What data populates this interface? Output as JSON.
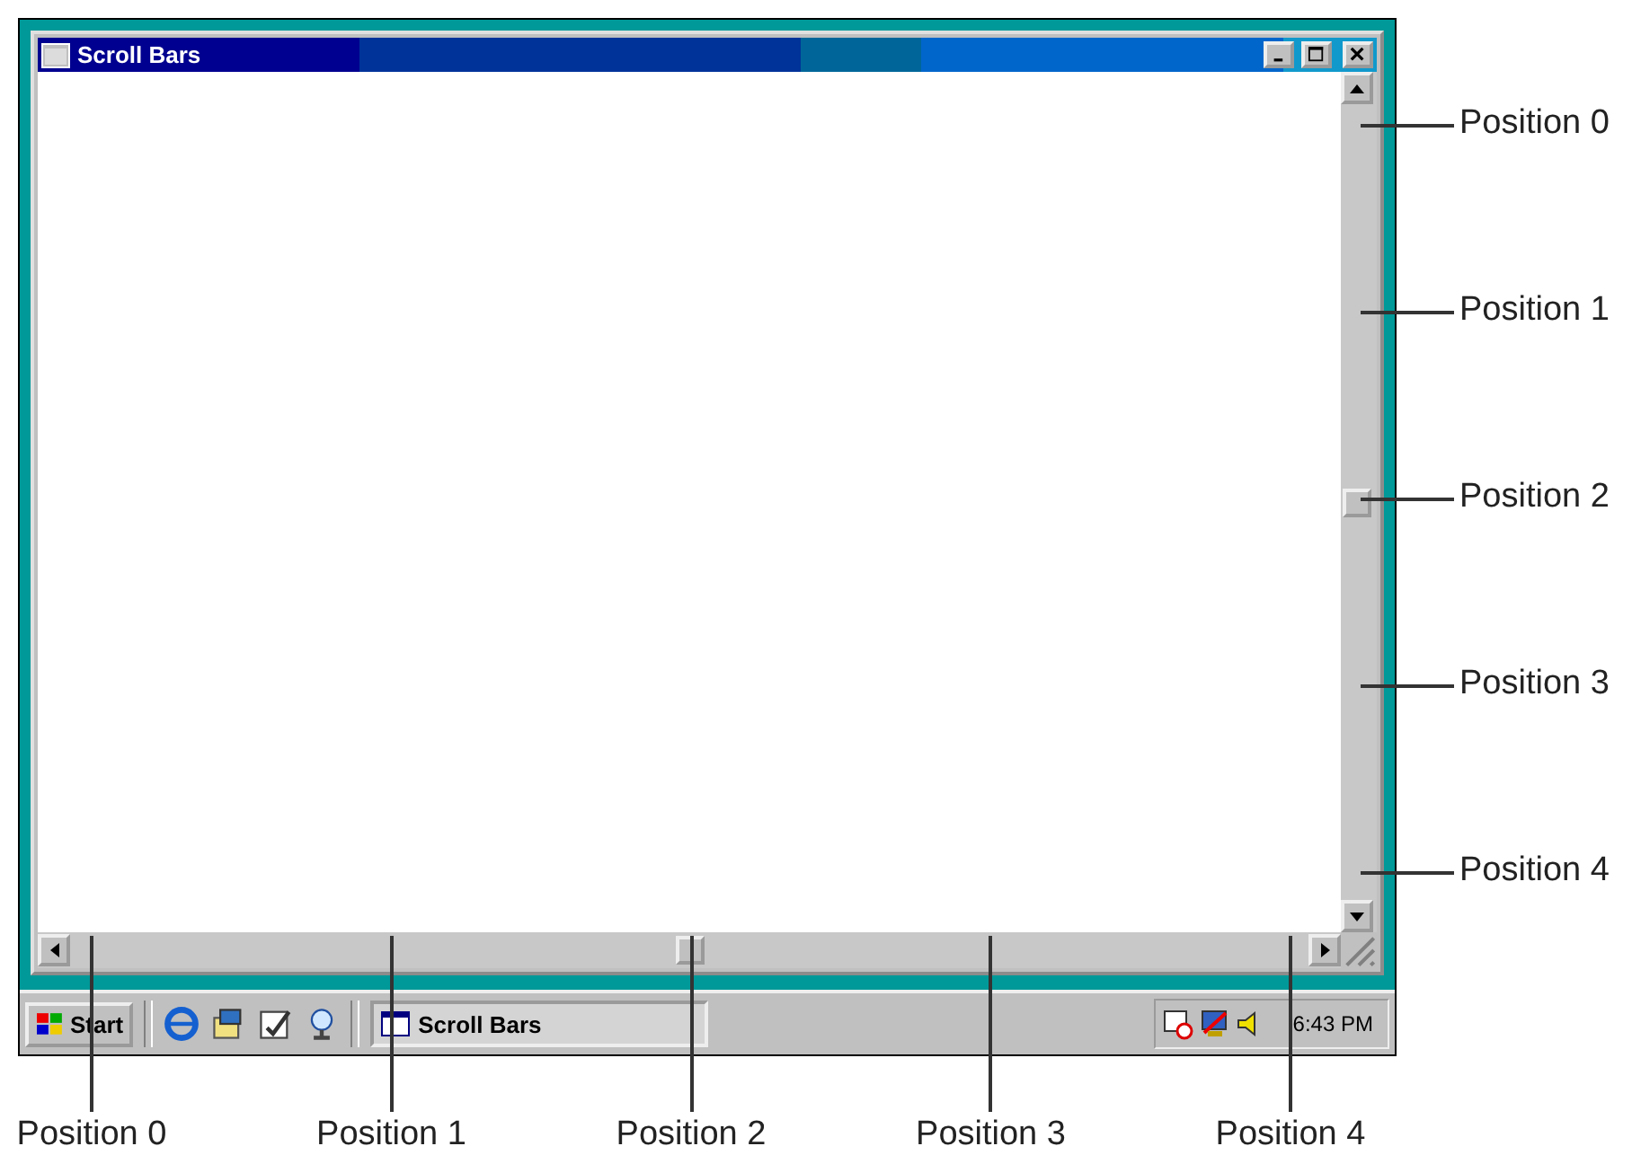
{
  "window": {
    "title": "Scroll Bars"
  },
  "scrollbars": {
    "vertical": {
      "level": 0.5
    },
    "horizontal": {
      "level": 0.5
    }
  },
  "taskbar": {
    "start": "Start",
    "task": "Scroll Bars",
    "clock": "6:43 PM"
  },
  "annotations": {
    "right": [
      "Position 0",
      "Position 1",
      "Position 2",
      "Position 3",
      "Position 4"
    ],
    "bottom": [
      "Position 0",
      "Position 1",
      "Position 2",
      "Position 3",
      "Position 4"
    ]
  }
}
